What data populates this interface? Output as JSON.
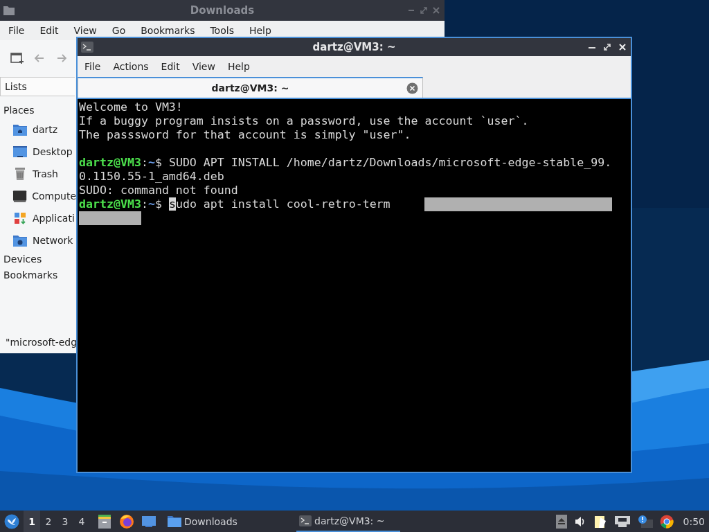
{
  "file_manager": {
    "title": "Downloads",
    "menu": [
      "File",
      "Edit",
      "View",
      "Go",
      "Bookmarks",
      "Tools",
      "Help"
    ],
    "side_tab": "Lists",
    "sections": [
      {
        "heading": "Places",
        "items": [
          {
            "label": "dartz",
            "kind": "home"
          },
          {
            "label": "Desktop",
            "kind": "desktop"
          },
          {
            "label": "Trash",
            "kind": "trash"
          },
          {
            "label": "Compute",
            "kind": "computer"
          },
          {
            "label": "Applicati",
            "kind": "applications"
          },
          {
            "label": "Network",
            "kind": "network"
          }
        ]
      },
      {
        "heading": "Devices"
      },
      {
        "heading": "Bookmarks"
      }
    ],
    "status": "\"microsoft-edg"
  },
  "terminal": {
    "title": "dartz@VM3: ~",
    "menu": [
      "File",
      "Actions",
      "Edit",
      "View",
      "Help"
    ],
    "tabs": [
      {
        "label": "dartz@VM3: ~",
        "selected": true
      }
    ],
    "lines": [
      {
        "kind": "text",
        "text": "Welcome to VM3!"
      },
      {
        "kind": "text",
        "text": "If a buggy program insists on a password, use the account `user`."
      },
      {
        "kind": "text",
        "text": "The passsword for that account is simply \"user\"."
      },
      {
        "kind": "blank"
      },
      {
        "kind": "prompt",
        "segments": [
          {
            "kind": "user",
            "text": "dartz@VM3"
          },
          {
            "kind": "plain",
            "text": ":"
          },
          {
            "kind": "path",
            "text": "~"
          },
          {
            "kind": "plain",
            "text": "$ SUDO APT INSTALL /home/dartz/Downloads/microsoft-edge-stable_99."
          }
        ]
      },
      {
        "kind": "text",
        "text": "0.1150.55-1_amd64.deb"
      },
      {
        "kind": "text",
        "text": "SUDO: command not found"
      },
      {
        "kind": "prompt",
        "segments": [
          {
            "kind": "user",
            "text": "dartz@VM3"
          },
          {
            "kind": "plain",
            "text": ":"
          },
          {
            "kind": "path",
            "text": "~"
          },
          {
            "kind": "plain",
            "text": "$ "
          },
          {
            "kind": "cursor",
            "text": "s"
          },
          {
            "kind": "plain",
            "text": "udo apt install cool-retro-term"
          }
        ]
      }
    ]
  },
  "taskbar": {
    "workspaces": [
      {
        "label": "1",
        "selected": true
      },
      {
        "label": "2",
        "selected": false
      },
      {
        "label": "3",
        "selected": false
      },
      {
        "label": "4",
        "selected": false
      }
    ],
    "tasks": [
      {
        "label": "Downloads",
        "kind": "folder",
        "selected": false
      },
      {
        "label": "dartz@VM3: ~",
        "kind": "terminal",
        "selected": true
      }
    ],
    "clock": "0:50"
  }
}
